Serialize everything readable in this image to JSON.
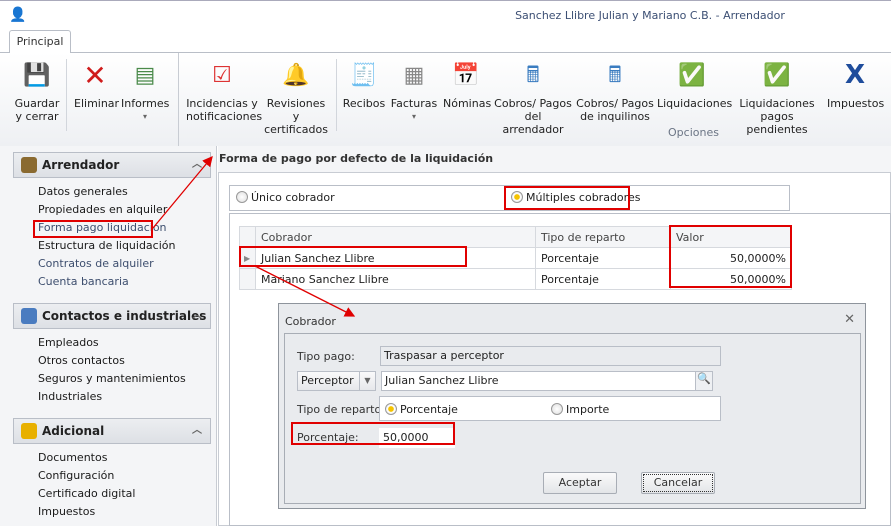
{
  "window": {
    "title": "Sanchez Llibre Julian y Mariano C.B. - Arrendador",
    "app_icon": "user-icon"
  },
  "ribbon": {
    "tab": "Principal",
    "group_label": "Opciones",
    "buttons": [
      {
        "label1": "Guardar",
        "label2": "y cerrar",
        "icon": "save-icon"
      },
      {
        "label1": "Eliminar",
        "label2": "",
        "icon": "delete-icon"
      },
      {
        "label1": "Informes",
        "label2": "▾",
        "icon": "report-icon"
      },
      {
        "label1": "Incidencias y",
        "label2": "notificaciones",
        "icon": "incidents-icon"
      },
      {
        "label1": "Revisiones y",
        "label2": "certificados",
        "icon": "bell-icon"
      },
      {
        "label1": "Recibos",
        "label2": "",
        "icon": "receipt-icon"
      },
      {
        "label1": "Facturas",
        "label2": "▾",
        "icon": "invoice-icon"
      },
      {
        "label1": "Nóminas",
        "label2": "",
        "icon": "calendar-icon"
      },
      {
        "label1": "Cobros/ Pagos",
        "label2": "del arrendador",
        "icon": "calculator-icon"
      },
      {
        "label1": "Cobros/ Pagos",
        "label2": "de inquilinos",
        "icon": "calculator-user-icon"
      },
      {
        "label1": "Liquidaciones",
        "label2": "",
        "icon": "settlement-icon"
      },
      {
        "label1": "Liquidaciones",
        "label2": "pagos pendientes",
        "icon": "settlement-pending-icon"
      },
      {
        "label1": "Impuestos",
        "label2": "",
        "icon": "tax-agency-icon"
      }
    ]
  },
  "sidebar": {
    "groups": [
      {
        "title": "Arrendador",
        "items": [
          "Datos generales",
          "Propiedades en alquiler",
          "Forma pago liquidación",
          "Estructura de liquidación",
          "Contratos de alquiler",
          "Cuenta bancaria"
        ]
      },
      {
        "title": "Contactos e industriales",
        "items": [
          "Empleados",
          "Otros contactos",
          "Seguros y mantenimientos",
          "Industriales"
        ]
      },
      {
        "title": "Adicional",
        "items": [
          "Documentos",
          "Configuración",
          "Certificado digital",
          "Impuestos"
        ]
      }
    ]
  },
  "main": {
    "title": "Forma de pago por defecto de la liquidación",
    "options": {
      "single": "Único cobrador",
      "multiple": "Múltiples cobradores",
      "selected": "multiple"
    },
    "grid": {
      "headers": [
        "Cobrador",
        "Tipo de reparto",
        "Valor"
      ],
      "rows": [
        [
          "Julian Sanchez Llibre",
          "Porcentaje",
          "50,0000%"
        ],
        [
          "Mariano Sanchez Llibre",
          "Porcentaje",
          "50,0000%"
        ]
      ]
    }
  },
  "dialog": {
    "title": "Cobrador",
    "tipo_pago_label": "Tipo pago:",
    "tipo_pago_value": "Traspasar a perceptor",
    "perceptor_select": "Perceptor",
    "perceptor_value": "Julian Sanchez Llibre",
    "reparto_label": "Tipo de reparto:",
    "reparto_options": [
      "Porcentaje",
      "Importe"
    ],
    "reparto_selected": "Porcentaje",
    "porcentaje_label": "Porcentaje:",
    "porcentaje_value": "50,0000",
    "accept": "Aceptar",
    "cancel": "Cancelar"
  },
  "colors": {
    "highlight": "#e00000",
    "radio_on": "#f5c300"
  }
}
